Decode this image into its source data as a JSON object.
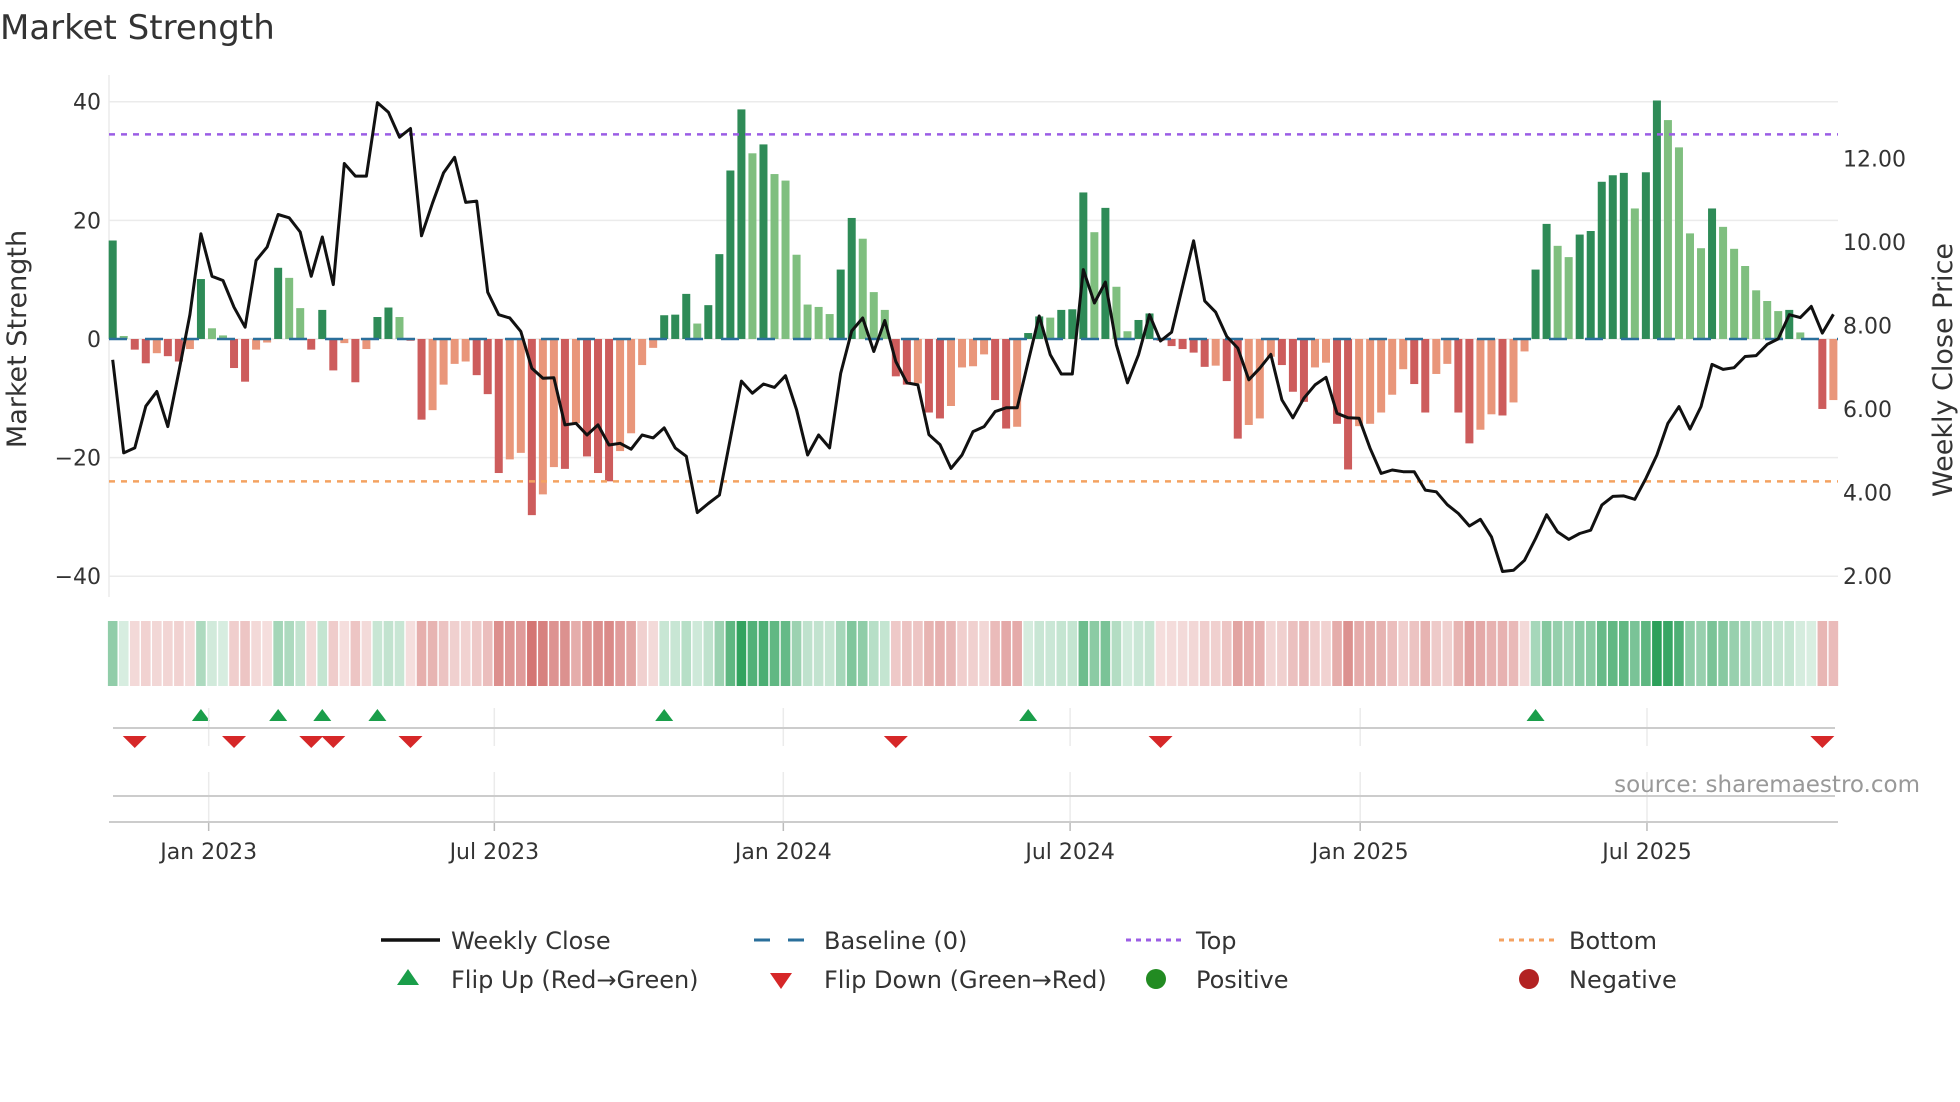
{
  "chart_data": {
    "type": "bar",
    "title": "Market Strength",
    "ylabel": "Market Strength",
    "ylabel_right": "Weekly Close Price",
    "ylim": [
      -43.5,
      44.5
    ],
    "ylim_right": [
      1.5,
      14.0
    ],
    "yticks": [
      {
        "v": 40,
        "label": "40"
      },
      {
        "v": 20,
        "label": "20"
      },
      {
        "v": 0,
        "label": "0"
      },
      {
        "v": -20,
        "label": "−20"
      },
      {
        "v": -40,
        "label": "−40"
      }
    ],
    "yticks_right": [
      {
        "v": 12,
        "label": "12.00"
      },
      {
        "v": 10,
        "label": "10.00"
      },
      {
        "v": 8,
        "label": "8.00"
      },
      {
        "v": 6,
        "label": "6.00"
      },
      {
        "v": 4,
        "label": "4.00"
      },
      {
        "v": 2,
        "label": "2.00"
      }
    ],
    "xticks": [
      {
        "week": 8.7,
        "label": "Jan 2023"
      },
      {
        "week": 34.6,
        "label": "Jul 2023"
      },
      {
        "week": 60.8,
        "label": "Jan 2024"
      },
      {
        "week": 86.8,
        "label": "Jul 2024"
      },
      {
        "week": 113.1,
        "label": "Jan 2025"
      },
      {
        "week": 139.1,
        "label": "Jul 2025"
      }
    ],
    "top_level": 34.5,
    "bottom_level": -24.0,
    "baseline": 0,
    "strength": [
      16.6,
      0.5,
      -1.8,
      -4.1,
      -2.4,
      -2.9,
      -3.8,
      -1.7,
      10.1,
      1.8,
      0.6,
      -4.9,
      -7.2,
      -1.8,
      -0.6,
      12.0,
      10.3,
      5.2,
      -1.8,
      4.9,
      -5.3,
      -0.7,
      -7.3,
      -1.7,
      3.7,
      5.3,
      3.7,
      -0.3,
      -13.6,
      -12.0,
      -7.7,
      -4.2,
      -3.8,
      -6.1,
      -9.3,
      -22.6,
      -20.3,
      -19.2,
      -29.7,
      -26.2,
      -21.6,
      -21.9,
      -14.2,
      -19.8,
      -22.6,
      -24.0,
      -18.9,
      -15.9,
      -4.4,
      -1.5,
      4.0,
      4.1,
      7.6,
      2.6,
      5.7,
      14.3,
      28.4,
      38.7,
      31.3,
      32.8,
      27.8,
      26.7,
      14.2,
      5.8,
      5.4,
      4.2,
      11.7,
      20.4,
      16.9,
      7.9,
      4.9,
      -6.3,
      -7.7,
      -7.5,
      -12.4,
      -13.4,
      -11.3,
      -4.8,
      -4.6,
      -2.6,
      -10.3,
      -15.1,
      -14.8,
      1.0,
      3.8,
      3.6,
      4.9,
      5.0,
      24.7,
      18.0,
      22.1,
      8.8,
      1.3,
      3.2,
      4.3,
      -0.3,
      -1.2,
      -1.7,
      -2.3,
      -4.7,
      -4.5,
      -7.1,
      -16.8,
      -14.5,
      -13.4,
      -3.0,
      -4.4,
      -8.9,
      -10.6,
      -4.8,
      -4.0,
      -14.3,
      -22.0,
      -14.7,
      -14.3,
      -12.4,
      -9.4,
      -5.1,
      -7.6,
      -12.4,
      -5.9,
      -4.2,
      -12.4,
      -17.6,
      -15.3,
      -12.7,
      -12.9,
      -10.7,
      -2.1,
      11.7,
      19.4,
      15.7,
      13.8,
      17.6,
      18.2,
      26.5,
      27.6,
      28.0,
      22.0,
      28.1,
      40.2,
      36.9,
      32.3,
      17.8,
      15.3,
      22.0,
      18.9,
      15.2,
      12.3,
      8.2,
      6.4,
      4.7,
      4.9,
      1.1,
      0.0,
      -11.8,
      -10.3
    ],
    "weekly_close": [
      7.18,
      4.95,
      5.07,
      6.07,
      6.42,
      5.58,
      6.9,
      8.26,
      10.2,
      9.18,
      9.08,
      8.44,
      7.96,
      9.56,
      9.88,
      10.66,
      10.58,
      10.24,
      9.18,
      10.12,
      8.98,
      11.88,
      11.58,
      11.58,
      13.34,
      13.11,
      12.51,
      12.72,
      10.15,
      10.94,
      11.66,
      12.03,
      10.95,
      10.98,
      8.8,
      8.26,
      8.18,
      7.86,
      6.98,
      6.74,
      6.75,
      5.62,
      5.66,
      5.38,
      5.62,
      5.14,
      5.18,
      5.04,
      5.38,
      5.31,
      5.55,
      5.07,
      4.87,
      3.52,
      3.74,
      3.94,
      5.3,
      6.67,
      6.38,
      6.6,
      6.52,
      6.8,
      5.98,
      4.9,
      5.38,
      5.07,
      6.86,
      7.87,
      8.18,
      7.38,
      8.12,
      7.14,
      6.63,
      6.58,
      5.39,
      5.15,
      4.58,
      4.9,
      5.46,
      5.58,
      5.94,
      6.03,
      6.03,
      7.14,
      8.23,
      7.3,
      6.84,
      6.84,
      9.34,
      8.54,
      9.04,
      7.54,
      6.63,
      7.3,
      8.26,
      7.63,
      7.84,
      8.94,
      10.03,
      8.59,
      8.32,
      7.74,
      7.46,
      6.7,
      6.98,
      7.31,
      6.22,
      5.79,
      6.26,
      6.58,
      6.76,
      5.9,
      5.79,
      5.78,
      5.06,
      4.46,
      4.54,
      4.5,
      4.5,
      4.06,
      4.02,
      3.71,
      3.5,
      3.2,
      3.36,
      2.94,
      2.11,
      2.14,
      2.38,
      2.9,
      3.47,
      3.06,
      2.88,
      3.02,
      3.1,
      3.7,
      3.91,
      3.92,
      3.84,
      4.34,
      4.9,
      5.66,
      6.06,
      5.52,
      6.06,
      7.07,
      6.95,
      6.99,
      7.26,
      7.28,
      7.55,
      7.68,
      8.26,
      8.19,
      8.46,
      7.82,
      8.27
    ],
    "grid": true,
    "legend_position": "bottom-center",
    "legend": [
      {
        "key": "line",
        "label": "Weekly Close"
      },
      {
        "key": "baseline",
        "label": "Baseline (0)"
      },
      {
        "key": "top",
        "label": "Top"
      },
      {
        "key": "bottom",
        "label": "Bottom"
      },
      {
        "key": "flip_up",
        "label": "Flip Up (Red→Green)"
      },
      {
        "key": "flip_down",
        "label": "Flip Down (Green→Red)"
      },
      {
        "key": "positive",
        "label": "Positive"
      },
      {
        "key": "negative",
        "label": "Negative"
      }
    ],
    "source": "source: sharemaestro.com"
  },
  "colors": {
    "pos_rising": "#2e8b57",
    "pos_falling": "#7fbf7f",
    "neg_falling": "#cd5c5c",
    "neg_rising": "#e9967a",
    "heat_pos": "#2ca05a",
    "heat_neg": "#c8504d",
    "line": "#111111",
    "baseline": "#2a6f9b",
    "top": "#9b5de5",
    "bottom": "#f4a261",
    "flip_up": "#1a9e4a",
    "flip_down": "#d62728",
    "positive": "#228b22",
    "negative": "#b22222",
    "grid": "#ebebeb"
  }
}
